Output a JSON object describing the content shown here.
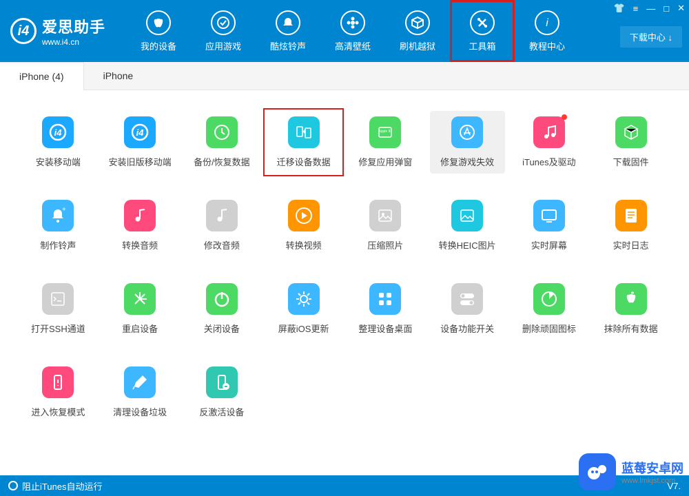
{
  "app": {
    "name": "爱思助手",
    "url": "www.i4.cn"
  },
  "window_controls": {
    "tshirt": "👕",
    "menu": "≡",
    "min": "—",
    "max": "□",
    "close": "✕"
  },
  "download_center": "下载中心 ↓",
  "nav": [
    {
      "label": "我的设备",
      "icon": "apple"
    },
    {
      "label": "应用游戏",
      "icon": "apps"
    },
    {
      "label": "酷炫铃声",
      "icon": "bell"
    },
    {
      "label": "高清壁纸",
      "icon": "flower"
    },
    {
      "label": "刷机越狱",
      "icon": "box"
    },
    {
      "label": "工具箱",
      "icon": "tools",
      "highlighted": true
    },
    {
      "label": "教程中心",
      "icon": "info"
    }
  ],
  "tabs": [
    {
      "label": "iPhone (4)",
      "active": true
    },
    {
      "label": "iPhone",
      "active": false
    }
  ],
  "tools": [
    {
      "label": "安装移动端",
      "bg": "bg-blue",
      "icon": "i4"
    },
    {
      "label": "安装旧版移动端",
      "bg": "bg-blue",
      "icon": "i4"
    },
    {
      "label": "备份/恢复数据",
      "bg": "bg-green",
      "icon": "restore"
    },
    {
      "label": "迁移设备数据",
      "bg": "bg-cyan",
      "icon": "transfer",
      "highlighted": true
    },
    {
      "label": "修复应用弹窗",
      "bg": "bg-green",
      "icon": "appleid"
    },
    {
      "label": "修复游戏失效",
      "bg": "bg-sky",
      "icon": "appstore",
      "hover": true
    },
    {
      "label": "iTunes及驱动",
      "bg": "bg-pink",
      "icon": "music",
      "dot": true
    },
    {
      "label": "下载固件",
      "bg": "bg-green",
      "icon": "cube"
    },
    {
      "label": "制作铃声",
      "bg": "bg-sky",
      "icon": "bell2"
    },
    {
      "label": "转换音频",
      "bg": "bg-pink",
      "icon": "audio"
    },
    {
      "label": "修改音频",
      "bg": "bg-gray",
      "icon": "audio2"
    },
    {
      "label": "转换视频",
      "bg": "bg-orange",
      "icon": "play"
    },
    {
      "label": "压缩照片",
      "bg": "bg-gray",
      "icon": "image"
    },
    {
      "label": "转换HEIC图片",
      "bg": "bg-cyan",
      "icon": "heic"
    },
    {
      "label": "实时屏幕",
      "bg": "bg-sky",
      "icon": "screen"
    },
    {
      "label": "实时日志",
      "bg": "bg-orange",
      "icon": "log"
    },
    {
      "label": "打开SSH通道",
      "bg": "bg-gray",
      "icon": "ssh"
    },
    {
      "label": "重启设备",
      "bg": "bg-green",
      "icon": "restart"
    },
    {
      "label": "关闭设备",
      "bg": "bg-green",
      "icon": "power"
    },
    {
      "label": "屏蔽iOS更新",
      "bg": "bg-sky",
      "icon": "gear"
    },
    {
      "label": "整理设备桌面",
      "bg": "bg-sky",
      "icon": "grid"
    },
    {
      "label": "设备功能开关",
      "bg": "bg-gray",
      "icon": "switch"
    },
    {
      "label": "删除顽固图标",
      "bg": "bg-green",
      "icon": "pie"
    },
    {
      "label": "抹除所有数据",
      "bg": "bg-green",
      "icon": "apple2"
    },
    {
      "label": "进入恢复模式",
      "bg": "bg-pink",
      "icon": "recovery"
    },
    {
      "label": "清理设备垃圾",
      "bg": "bg-sky",
      "icon": "clean"
    },
    {
      "label": "反激活设备",
      "bg": "bg-teal",
      "icon": "deactivate"
    }
  ],
  "footer": {
    "itunes": "阻止iTunes自动运行",
    "version": "V7."
  },
  "watermark": {
    "main": "蓝莓安卓网",
    "sub": "www.lmkjst.com"
  }
}
